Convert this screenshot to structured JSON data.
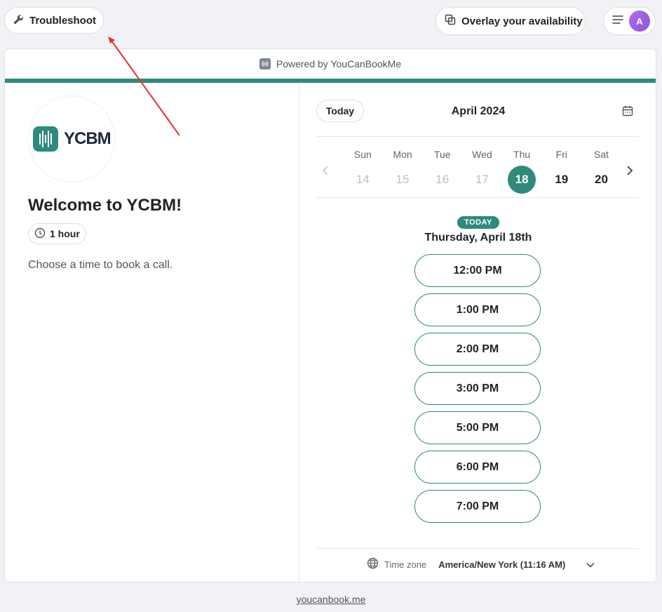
{
  "topbar": {
    "troubleshoot_label": "Troubleshoot",
    "overlay_label": "Overlay your availability",
    "avatar_initial": "A"
  },
  "card": {
    "powered_by": "Powered by YouCanBookMe",
    "accent_color": "#2d8a7c"
  },
  "profile": {
    "logo_text": "YCBM",
    "title": "Welcome to YCBM!",
    "duration": "1 hour",
    "description": "Choose a time to book a call."
  },
  "calendar": {
    "today_label": "Today",
    "month": "April 2024",
    "days": [
      {
        "name": "Sun",
        "date": "14",
        "state": "past"
      },
      {
        "name": "Mon",
        "date": "15",
        "state": "past"
      },
      {
        "name": "Tue",
        "date": "16",
        "state": "past"
      },
      {
        "name": "Wed",
        "date": "17",
        "state": "past"
      },
      {
        "name": "Thu",
        "date": "18",
        "state": "selected"
      },
      {
        "name": "Fri",
        "date": "19",
        "state": "available"
      },
      {
        "name": "Sat",
        "date": "20",
        "state": "available"
      }
    ],
    "today_badge": "TODAY",
    "selected_date": "Thursday, April 18th",
    "slots": [
      "12:00 PM",
      "1:00 PM",
      "2:00 PM",
      "3:00 PM",
      "5:00 PM",
      "6:00 PM",
      "7:00 PM"
    ]
  },
  "timezone": {
    "label": "Time zone",
    "value": "America/New York (11:16 AM)"
  },
  "footer": {
    "link": "youcanbook.me"
  },
  "annotation": {
    "arrow_color": "#e8312f"
  }
}
